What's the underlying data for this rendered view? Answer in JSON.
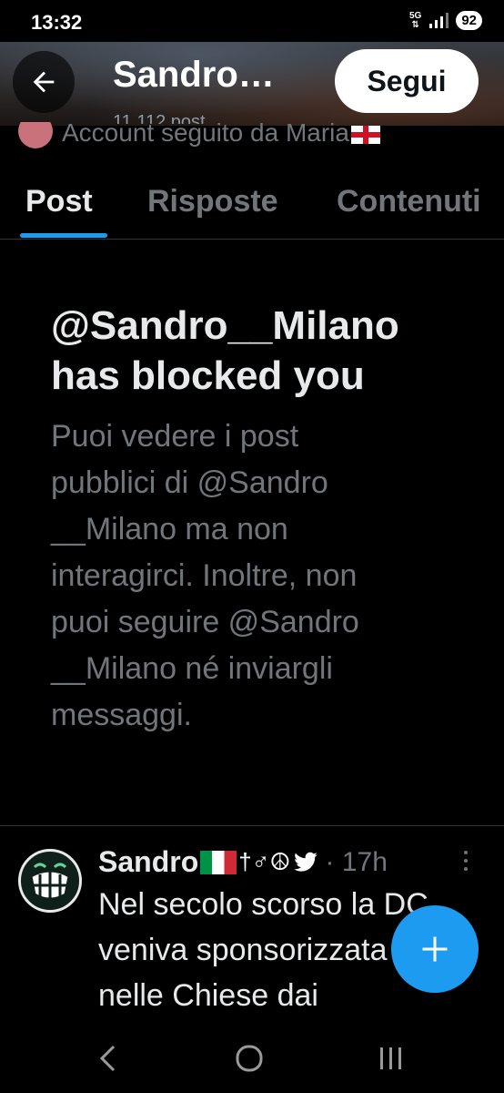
{
  "status_bar": {
    "time": "13:32",
    "network": "5G",
    "battery": "92"
  },
  "header": {
    "name": "Sandro…",
    "subtitle": "11.112 post",
    "follow_label": "Segui",
    "followed_by": "Account seguito da Maria"
  },
  "tabs": [
    {
      "label": "Post",
      "active": true
    },
    {
      "label": "Risposte",
      "active": false
    },
    {
      "label": "Contenuti",
      "active": false
    }
  ],
  "blocked": {
    "title": "@Sandro__Milano has blocked you",
    "body": "Puoi vedere i post\npubblici di @Sandro\n__Milano ma non\ninteragirci. Inoltre, non\npuoi seguire @Sandro\n__Milano né inviargli\nmessaggi."
  },
  "tweet": {
    "author": "Sandro",
    "emoji_suffix": "†♂☮",
    "time": "· 17h",
    "text": "Nel secolo scorso la DC\nveniva sponsorizzata\nnelle Chiese dai"
  },
  "icons": {
    "back": "arrow-left-icon",
    "compose": "plus-icon",
    "more": "more-vertical-icon",
    "nav": [
      "back-chevron-icon",
      "home-circle-icon",
      "recents-icon"
    ]
  },
  "colors": {
    "accent": "#1d9bf0",
    "background": "#000000",
    "muted_text": "#71767b"
  }
}
